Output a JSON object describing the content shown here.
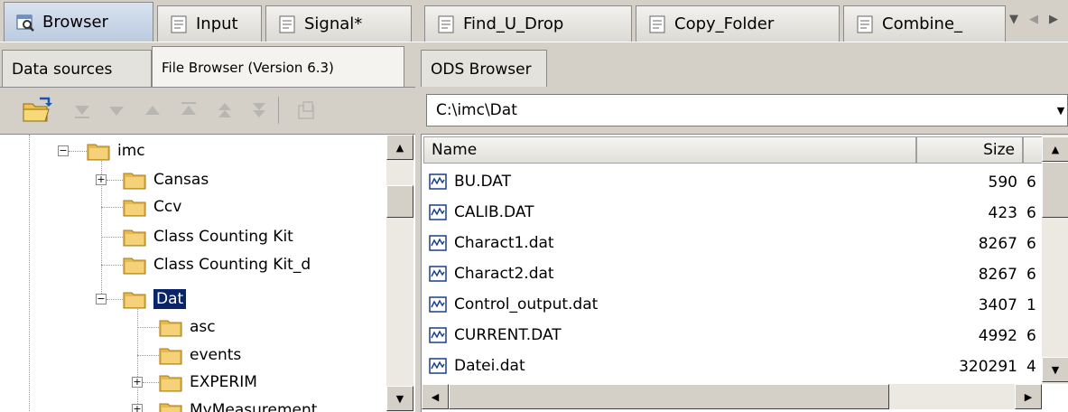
{
  "tabs": [
    {
      "label": "Browser",
      "icon": "browser-icon",
      "active": true
    },
    {
      "label": "Input",
      "icon": "document-icon"
    },
    {
      "label": "Signal*",
      "icon": "document-icon"
    },
    {
      "label": "Find_U_Drop",
      "icon": "document-icon"
    },
    {
      "label": "Copy_Folder",
      "icon": "document-icon"
    },
    {
      "label": "Combine_",
      "icon": "document-icon"
    }
  ],
  "subtabs": {
    "data_sources": "Data sources",
    "file_browser": "File Browser (Version 6.3)",
    "ods_browser": "ODS Browser"
  },
  "path": {
    "value": "C:\\imc\\Dat"
  },
  "tree": {
    "items": [
      {
        "label": "imc",
        "expander": "−"
      },
      {
        "label": "Cansas",
        "expander": "+"
      },
      {
        "label": "Ccv"
      },
      {
        "label": "Class Counting Kit"
      },
      {
        "label": "Class Counting Kit_d"
      },
      {
        "label": "Dat",
        "expander": "−",
        "selected": true
      },
      {
        "label": "asc"
      },
      {
        "label": "events"
      },
      {
        "label": "EXPERIM",
        "expander": "+"
      },
      {
        "label": "MyMeasurement",
        "expander": "+"
      }
    ]
  },
  "file_list": {
    "columns": {
      "name": "Name",
      "size": "Size"
    },
    "rows": [
      {
        "name": "BU.DAT",
        "size": "590",
        "date": "6"
      },
      {
        "name": "CALIB.DAT",
        "size": "423",
        "date": "6"
      },
      {
        "name": "Charact1.dat",
        "size": "8267",
        "date": "6"
      },
      {
        "name": "Charact2.dat",
        "size": "8267",
        "date": "6"
      },
      {
        "name": "Control_output.dat",
        "size": "3407",
        "date": "1"
      },
      {
        "name": "CURRENT.DAT",
        "size": "4992",
        "date": "6"
      },
      {
        "name": "Datei.dat",
        "size": "320291",
        "date": "4"
      }
    ]
  },
  "colors": {
    "selection": "#0a246a",
    "folder": "#e8b84a"
  }
}
